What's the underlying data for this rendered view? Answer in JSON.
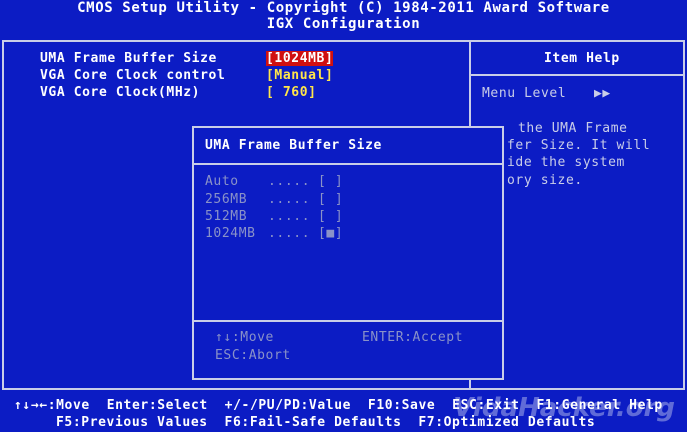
{
  "header": {
    "title": "CMOS Setup Utility - Copyright (C) 1984-2011 Award Software",
    "subtitle": "IGX Configuration"
  },
  "settings": [
    {
      "label": "UMA Frame Buffer Size",
      "value": "[1024MB]"
    },
    {
      "label": "VGA Core Clock control",
      "value": "[Manual]"
    },
    {
      "label": "VGA Core Clock(MHz)",
      "value": "[ 760]"
    }
  ],
  "item_help": {
    "title": "Item Help",
    "menu_level": "Menu Level",
    "menu_level_arrows": "▶▶",
    "text_lines": [
      "the UMA Frame",
      "fer Size. It will",
      "ide the system",
      "ory size."
    ]
  },
  "popup": {
    "title": "UMA Frame Buffer Size",
    "options": [
      {
        "label": "Auto",
        "dots": ".....",
        "mark": "[ ]"
      },
      {
        "label": "256MB",
        "dots": ".....",
        "mark": "[ ]"
      },
      {
        "label": "512MB",
        "dots": ".....",
        "mark": "[ ]"
      },
      {
        "label": "1024MB",
        "dots": ".....",
        "mark": "[■]"
      }
    ],
    "hint_move": "↑↓:Move",
    "hint_accept": "ENTER:Accept",
    "hint_abort": "ESC:Abort"
  },
  "footer": {
    "line1": "↑↓→←:Move  Enter:Select  +/-/PU/PD:Value  F10:Save  ESC:Exit  F1:General Help",
    "line2": "F5:Previous Values  F6:Fail-Safe Defaults  F7:Optimized Defaults"
  },
  "watermark": "VidaHacker.org"
}
